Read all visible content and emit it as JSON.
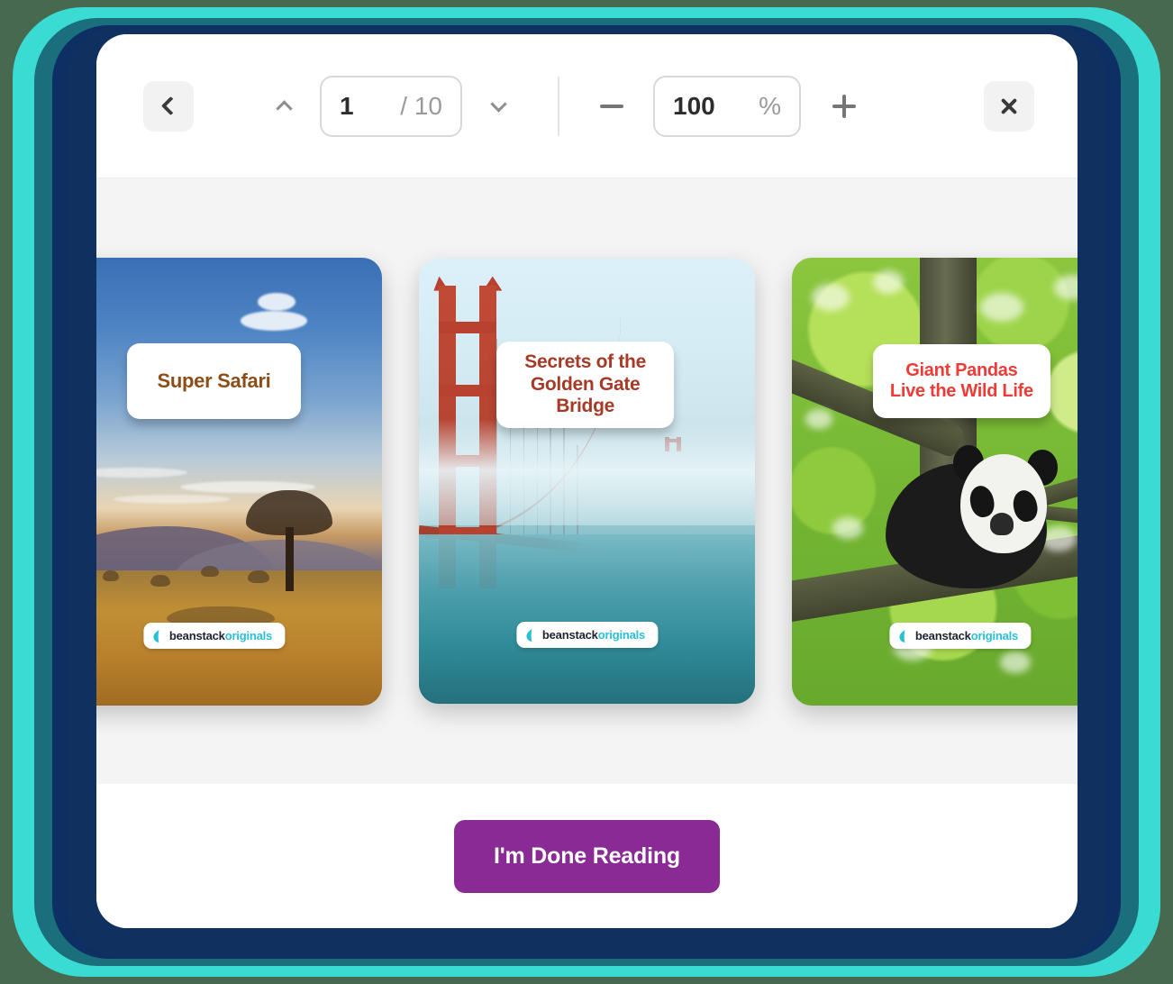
{
  "frame": {
    "background_color": "#47694f",
    "ring_outer_color": "#3adbd2",
    "ring_mid_color": "#1b6e7c",
    "ring_inner_color": "#0e2f63"
  },
  "toolbar": {
    "back_icon": "chevron-left-icon",
    "page_up_icon": "chevron-up-icon",
    "page_down_icon": "chevron-down-icon",
    "current_page": "1",
    "total_pages": "/ 10",
    "zoom_out_icon": "minus-icon",
    "zoom_in_icon": "plus-icon",
    "zoom_value": "100",
    "zoom_unit": "%",
    "close_icon": "close-icon"
  },
  "reader": {
    "books": [
      {
        "title": "Super Safari",
        "title_color": "#8C4E18",
        "brand_primary": "beanstack",
        "brand_secondary": "originals",
        "artwork": "savanna-sunset-acacia-tree"
      },
      {
        "title": "Secrets of the\nGolden Gate\nBridge",
        "title_color": "#A53B27",
        "brand_primary": "beanstack",
        "brand_secondary": "originals",
        "artwork": "golden-gate-bridge-in-fog"
      },
      {
        "title": "Giant Pandas\nLive the Wild Life",
        "title_color": "#EE3B36",
        "brand_primary": "beanstack",
        "brand_secondary": "originals",
        "artwork": "panda-resting-in-tree"
      }
    ]
  },
  "footer": {
    "done_reading_label": "I'm Done Reading",
    "done_reading_color": "#8a2a94"
  }
}
